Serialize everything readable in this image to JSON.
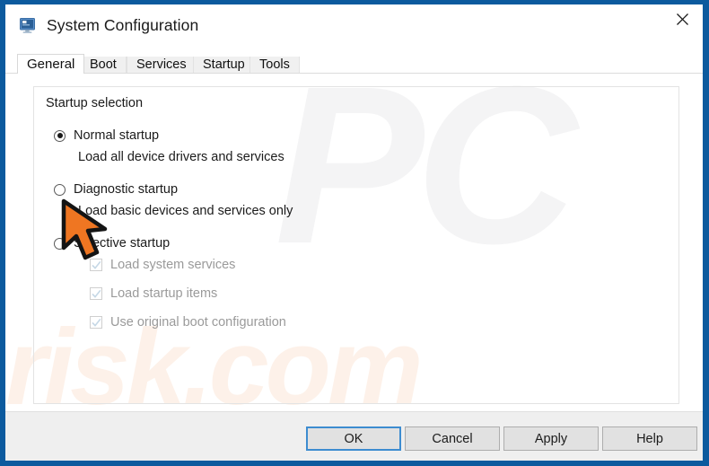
{
  "window": {
    "title": "System Configuration",
    "icon": "system-configuration-icon",
    "close_label": "✕",
    "frame_color": "#0c5a9e",
    "accent_color": "#3d8cd0"
  },
  "tabs": [
    {
      "label": "General",
      "active": true
    },
    {
      "label": "Boot",
      "active": false
    },
    {
      "label": "Services",
      "active": false
    },
    {
      "label": "Startup",
      "active": false
    },
    {
      "label": "Tools",
      "active": false
    }
  ],
  "group": {
    "legend": "Startup selection"
  },
  "options": [
    {
      "id": "normal",
      "label": "Normal startup",
      "description": "Load all device drivers and services",
      "selected": true
    },
    {
      "id": "diagnostic",
      "label": "Diagnostic startup",
      "description": "Load basic devices and services only",
      "selected": false
    },
    {
      "id": "selective",
      "label": "Selective startup",
      "description": "",
      "selected": false
    }
  ],
  "selective_items": [
    {
      "label": "Load system services",
      "checked": true,
      "disabled": true
    },
    {
      "label": "Load startup items",
      "checked": true,
      "disabled": true
    },
    {
      "label": "Use original boot configuration",
      "checked": true,
      "disabled": true
    }
  ],
  "footer": {
    "buttons": [
      {
        "label": "OK",
        "default": true
      },
      {
        "label": "Cancel",
        "default": false
      },
      {
        "label": "Apply",
        "default": false
      },
      {
        "label": "Help",
        "default": false
      }
    ]
  },
  "watermarks": {
    "top": "PC",
    "bottom": "risk.com"
  },
  "cursor": {
    "name": "arrow-cursor",
    "color": "#ef7622"
  }
}
